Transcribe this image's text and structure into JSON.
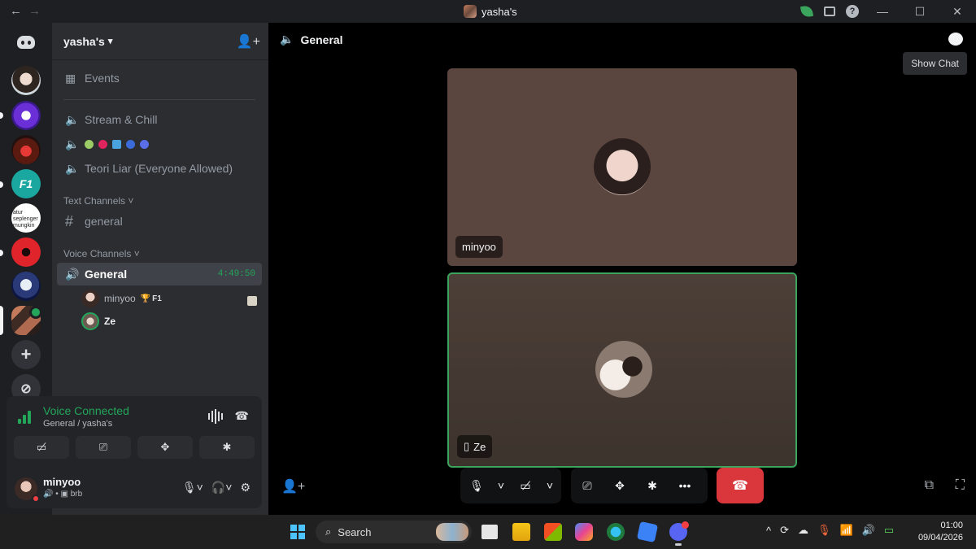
{
  "titlebar": {
    "title": "yasha's",
    "back_icon": "arrow-left-icon",
    "forward_icon": "arrow-right-icon"
  },
  "server_header": {
    "name": "yasha's"
  },
  "channels": {
    "events_label": "Events",
    "voice_top": [
      {
        "label": "Stream & Chill"
      },
      {
        "label": ""
      },
      {
        "label": "Teori Liar (Everyone Allowed)"
      }
    ],
    "text_category": "Text Channels",
    "text_channels": [
      {
        "label": "general"
      }
    ],
    "voice_category": "Voice Channels",
    "active_voice": {
      "label": "General",
      "timer": "4:49:50"
    },
    "voice_users": [
      {
        "name": "minyoo",
        "tag": "F1"
      },
      {
        "name": "Ze"
      }
    ]
  },
  "server_list": [
    {
      "icon": "portrait-server"
    },
    {
      "icon": "purple-server"
    },
    {
      "icon": "monster-server"
    },
    {
      "icon": "f1-server"
    },
    {
      "icon": "text-server",
      "text": "atur seplenger mungkin"
    },
    {
      "icon": "red-server"
    },
    {
      "icon": "skeleton-server"
    },
    {
      "icon": "yashas-server"
    }
  ],
  "voice_panel": {
    "status": "Voice Connected",
    "location": "General / yasha's"
  },
  "user": {
    "name": "minyoo",
    "status": "brb"
  },
  "main": {
    "channel_title": "General",
    "tooltip": "Show Chat",
    "tiles": [
      {
        "name": "minyoo"
      },
      {
        "name": "Ze"
      }
    ]
  },
  "taskbar": {
    "search_placeholder": "Search",
    "time": "01:00",
    "date": "09/04/2026"
  },
  "colors": {
    "accent_green": "#23a55a",
    "danger_red": "#da373c",
    "bg_dark": "#1e1f22"
  }
}
